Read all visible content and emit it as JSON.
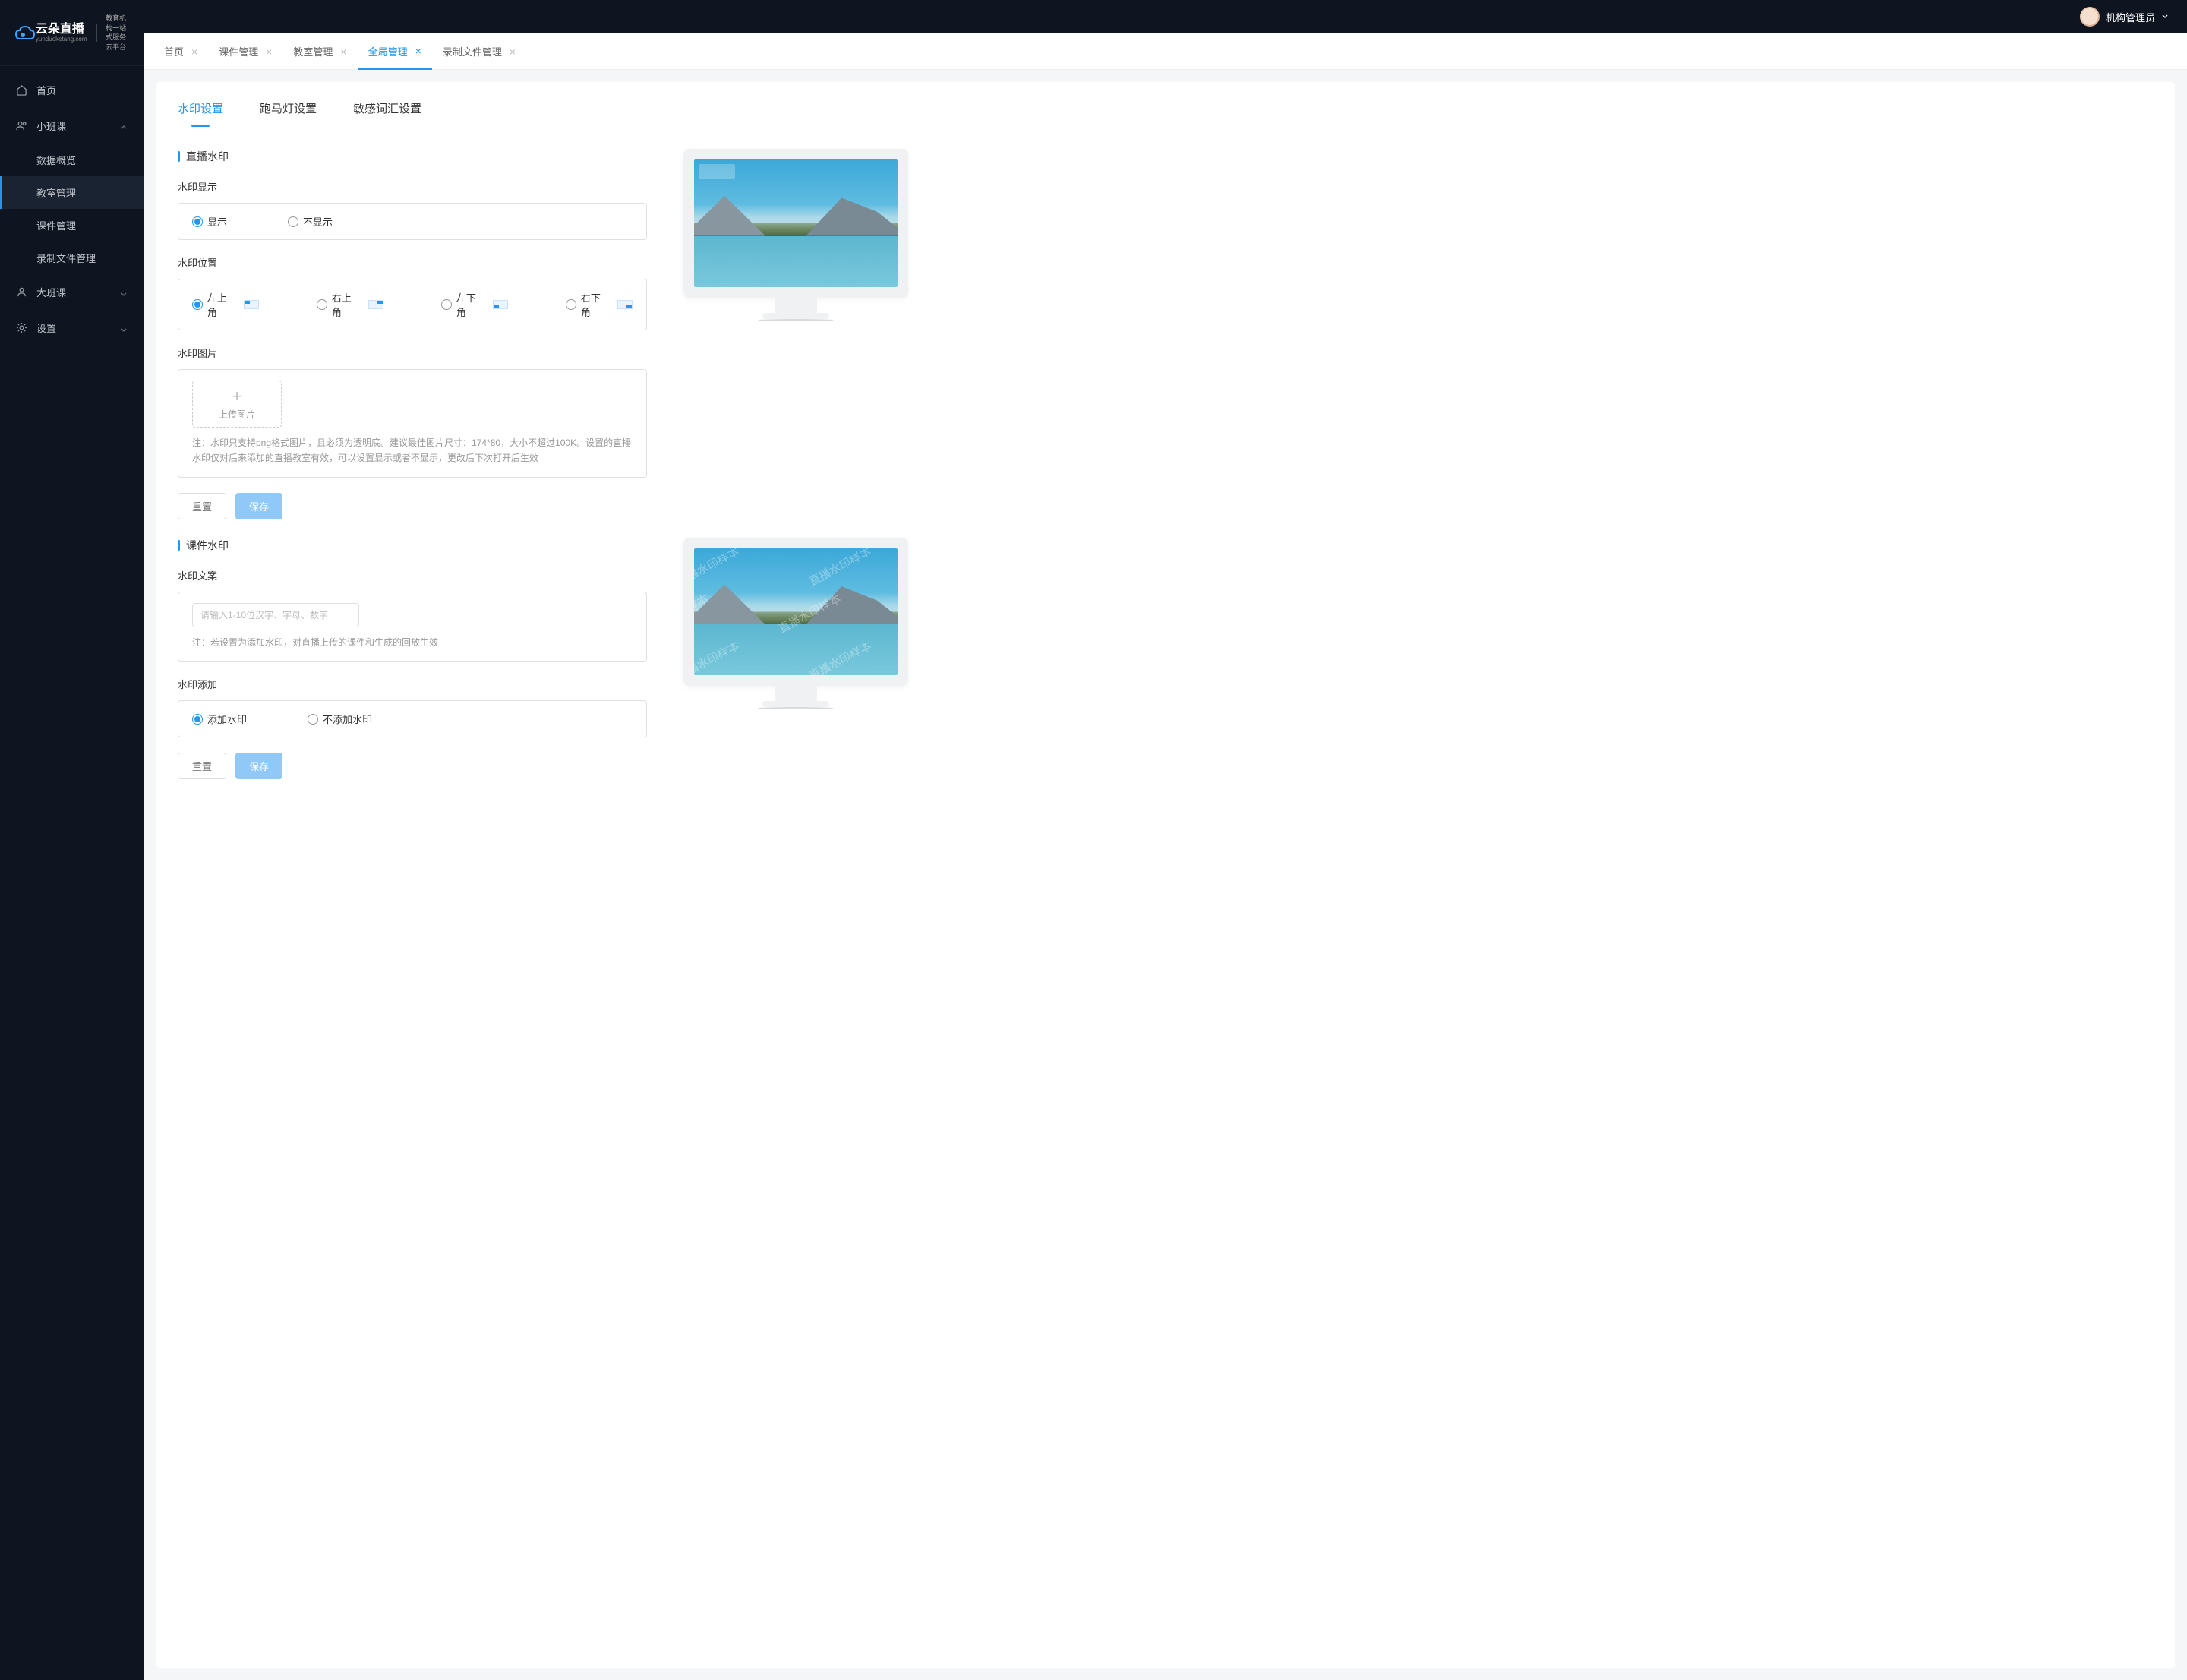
{
  "logo": {
    "main": "云朵直播",
    "sub": "yunduoketang.com",
    "tagline1": "教育机构一站",
    "tagline2": "式服务云平台"
  },
  "header": {
    "user_name": "机构管理员"
  },
  "sidebar": {
    "items": [
      {
        "label": "首页",
        "icon": "home"
      },
      {
        "label": "小班课",
        "icon": "users",
        "expanded": true,
        "children": [
          {
            "label": "数据概览"
          },
          {
            "label": "教室管理",
            "active": true
          },
          {
            "label": "课件管理"
          },
          {
            "label": "录制文件管理"
          }
        ]
      },
      {
        "label": "大班课",
        "icon": "users-line"
      },
      {
        "label": "设置",
        "icon": "gear"
      }
    ]
  },
  "tabs": [
    {
      "label": "首页",
      "closable": true
    },
    {
      "label": "课件管理",
      "closable": true
    },
    {
      "label": "教室管理",
      "closable": true
    },
    {
      "label": "全局管理",
      "closable": true,
      "active": true
    },
    {
      "label": "录制文件管理",
      "closable": true
    }
  ],
  "content_tabs": [
    {
      "label": "水印设置",
      "active": true
    },
    {
      "label": "跑马灯设置"
    },
    {
      "label": "敏感词汇设置"
    }
  ],
  "section1": {
    "title": "直播水印",
    "display_label": "水印显示",
    "display_options": [
      "显示",
      "不显示"
    ],
    "position_label": "水印位置",
    "position_options": [
      "左上角",
      "右上角",
      "左下角",
      "右下角"
    ],
    "image_label": "水印图片",
    "upload_label": "上传图片",
    "hint": "注：水印只支持png格式图片，且必须为透明底。建议最佳图片尺寸：174*80，大小不超过100K。设置的直播水印仅对后来添加的直播教室有效，可以设置显示或者不显示，更改后下次打开后生效",
    "reset_label": "重置",
    "save_label": "保存"
  },
  "section2": {
    "title": "课件水印",
    "text_label": "水印文案",
    "text_placeholder": "请输入1-10位汉字、字母、数字",
    "hint": "注：若设置为添加水印，对直播上传的课件和生成的回放生效",
    "add_label": "水印添加",
    "add_options": [
      "添加水印",
      "不添加水印"
    ],
    "reset_label": "重置",
    "save_label": "保存",
    "sample_text": "直播水印样本"
  }
}
